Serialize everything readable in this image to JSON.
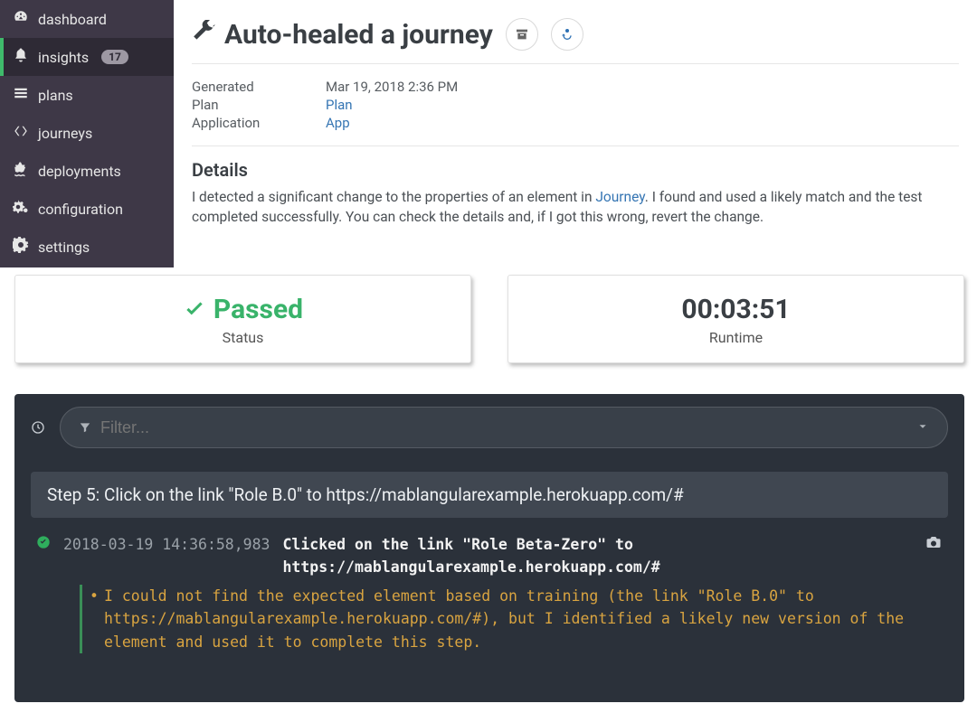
{
  "sidebar": {
    "items": [
      {
        "label": "dashboard",
        "icon": "gauge"
      },
      {
        "label": "insights",
        "icon": "bell",
        "badge": "17",
        "active": true
      },
      {
        "label": "plans",
        "icon": "list"
      },
      {
        "label": "journeys",
        "icon": "code-brackets"
      },
      {
        "label": "deployments",
        "icon": "ship"
      },
      {
        "label": "configuration",
        "icon": "cogs"
      },
      {
        "label": "settings",
        "icon": "gear"
      }
    ]
  },
  "page": {
    "title": "Auto-healed a journey",
    "meta": {
      "generated_label": "Generated",
      "generated_value": "Mar 19, 2018 2:36 PM",
      "plan_label": "Plan",
      "plan_link": "Plan",
      "application_label": "Application",
      "application_link": "App"
    },
    "details_heading": "Details",
    "details_text_before": "I detected a significant change to the properties of an element in ",
    "details_link": "Journey",
    "details_text_after": ". I found and used a likely match and the test completed successfully. You can check the details and, if I got this wrong, revert the change."
  },
  "cards": {
    "status_value": "Passed",
    "status_label": "Status",
    "runtime_value": "00:03:51",
    "runtime_label": "Runtime"
  },
  "log": {
    "filter_placeholder": "Filter...",
    "step_header": "Step 5: Click on the link \"Role B.0\" to https://mablangularexample.herokuapp.com/#",
    "entry": {
      "timestamp": "2018-03-19 14:36:58,983",
      "message": "Clicked on the link \"Role Beta-Zero\" to https://mablangularexample.herokuapp.com/#",
      "note": "I could not find the expected element based on training (the link \"Role B.0\" to https://mablangularexample.herokuapp.com/#), but I identified a likely new version of the element and used it to complete this step."
    }
  }
}
